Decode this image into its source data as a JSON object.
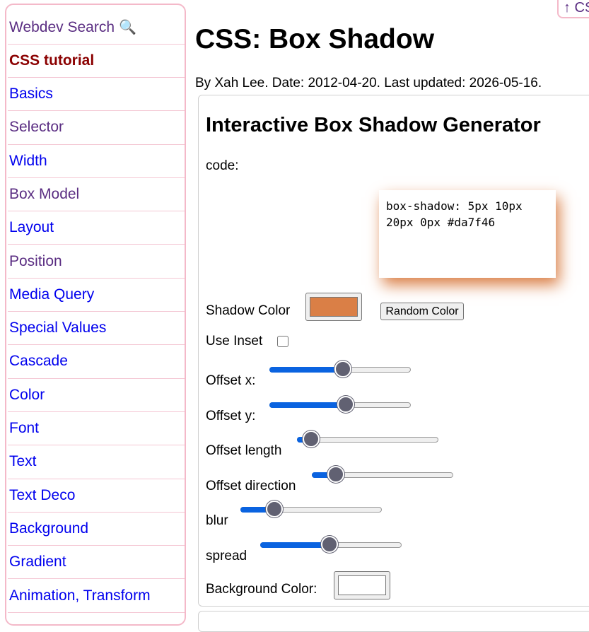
{
  "sidebar": {
    "search_label": "Webdev Search",
    "search_icon": "magnifier-icon",
    "heading": "CSS tutorial",
    "items": [
      {
        "label": "Basics",
        "visited": false
      },
      {
        "label": "Selector",
        "visited": true
      },
      {
        "label": "Width",
        "visited": false
      },
      {
        "label": "Box Model",
        "visited": true
      },
      {
        "label": "Layout",
        "visited": false
      },
      {
        "label": "Position",
        "visited": true
      },
      {
        "label": "Media Query",
        "visited": false
      },
      {
        "label": "Special Values",
        "visited": false
      },
      {
        "label": "Cascade",
        "visited": false
      },
      {
        "label": "Color",
        "visited": false
      },
      {
        "label": "Font",
        "visited": false
      },
      {
        "label": "Text",
        "visited": false
      },
      {
        "label": "Text Deco",
        "visited": false
      },
      {
        "label": "Background",
        "visited": false
      },
      {
        "label": "Gradient",
        "visited": false
      },
      {
        "label": "Animation, Transform",
        "visited": false
      }
    ]
  },
  "corner_link": "↑ CS",
  "page": {
    "title": "CSS: Box Shadow",
    "byline": "By Xah Lee. Date: 2012-04-20. Last updated: 2026-05-16."
  },
  "generator": {
    "title": "Interactive Box Shadow Generator",
    "code_label": "code:",
    "code_value": "box-shadow: 5px 10px 20px 0px #da7f46",
    "shadow_color_label": "Shadow Color",
    "shadow_color": "#da7f46",
    "random_color_button": "Random Color",
    "use_inset_label": "Use Inset",
    "use_inset_checked": false,
    "sliders": {
      "offset_x": {
        "label": "Offset x:",
        "value_fraction": 0.52
      },
      "offset_y": {
        "label": "Offset y:",
        "value_fraction": 0.54
      },
      "offset_length": {
        "label": "Offset length",
        "value_fraction": 0.1
      },
      "offset_direction": {
        "label": "Offset direction",
        "value_fraction": 0.17
      },
      "blur": {
        "label": "blur",
        "value_fraction": 0.24
      },
      "spread": {
        "label": "spread",
        "value_fraction": 0.49
      }
    },
    "background_color_label": "Background Color:",
    "background_color": "#ffffff"
  },
  "colors": {
    "sidebar_border": "#f4b9c9",
    "link": "#0000ee",
    "visited_link": "#5a2d82",
    "heading": "#8b0000",
    "slider_fill": "#0a63e0"
  }
}
